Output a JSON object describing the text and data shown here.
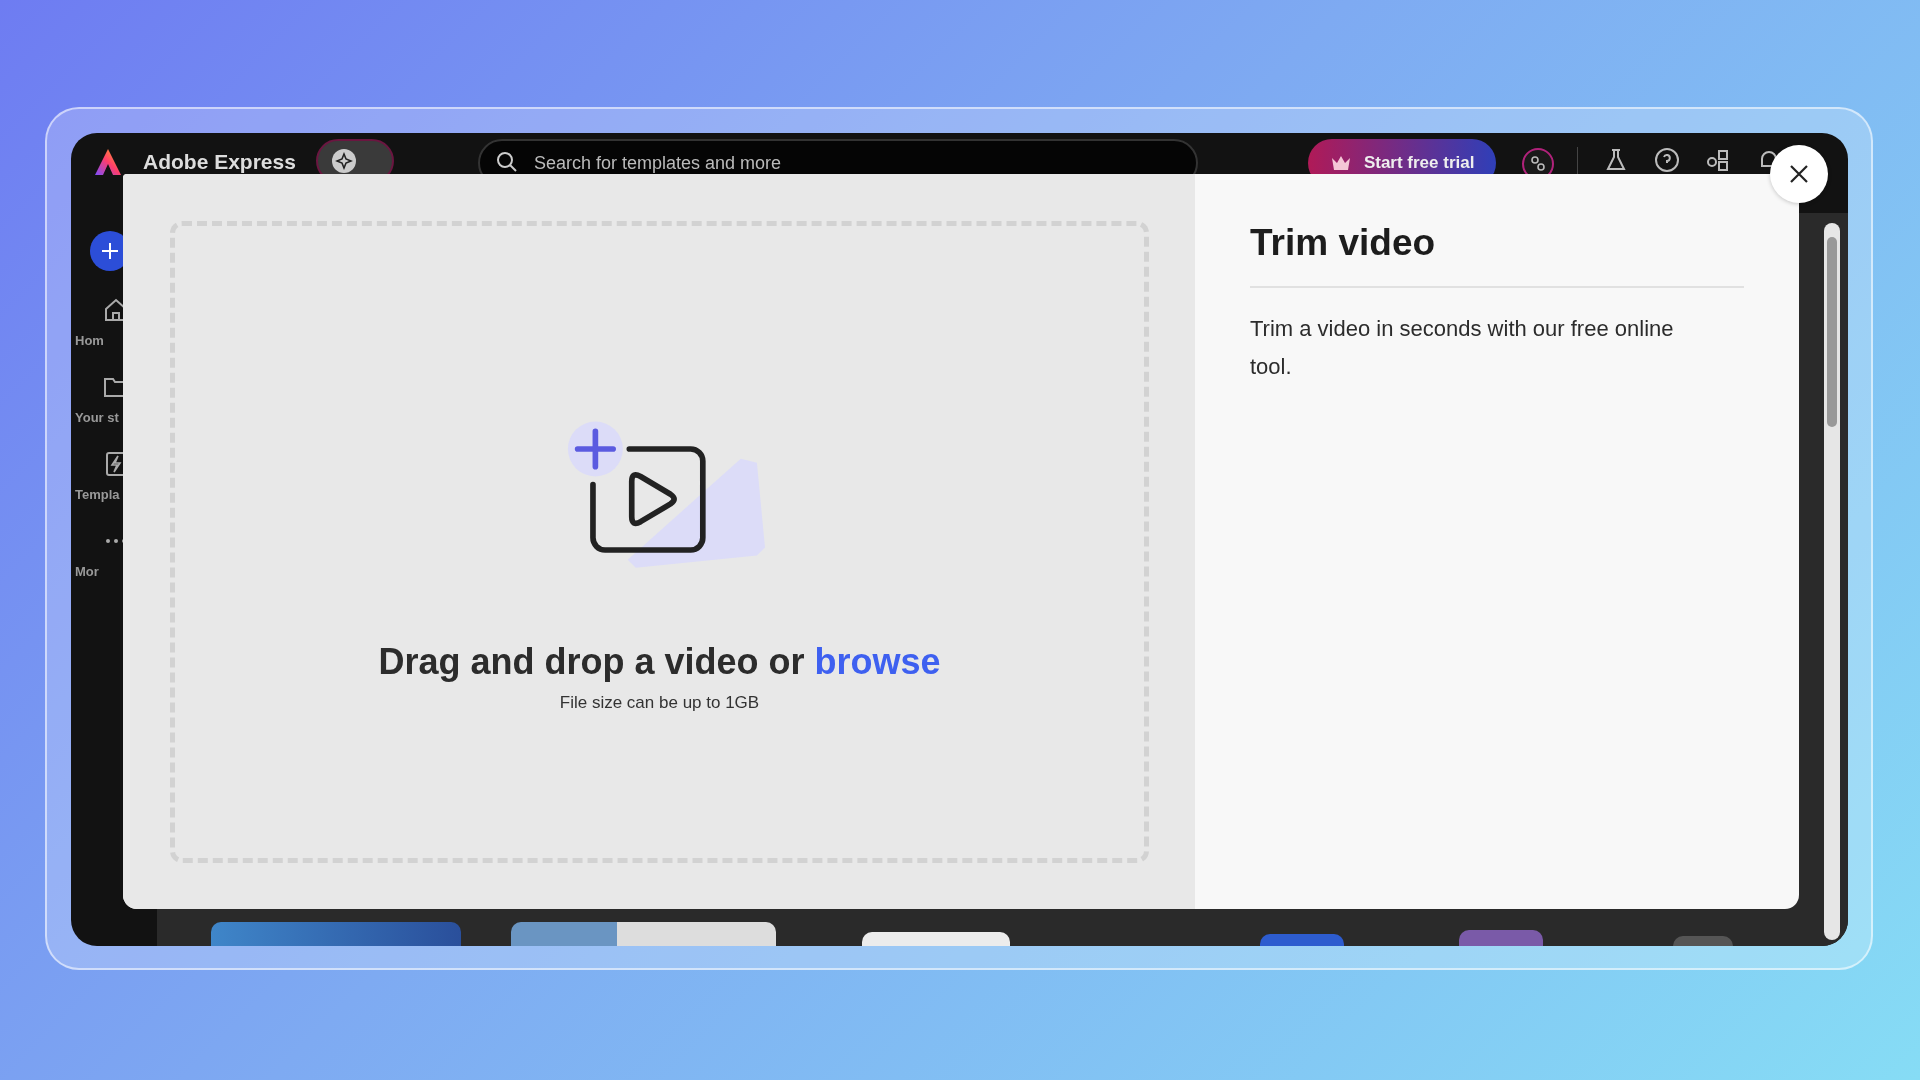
{
  "app": {
    "brand": "Adobe Express",
    "search": {
      "placeholder": "Search for templates and more"
    },
    "trial_button": "Start free trial",
    "sidebar": [
      {
        "kind": "home",
        "label": "Hom"
      },
      {
        "kind": "folder",
        "label": "Your st"
      },
      {
        "kind": "templates",
        "label": "Templa"
      },
      {
        "kind": "more",
        "label": "Mor"
      }
    ]
  },
  "dialog": {
    "drop_text": "Drag and drop a video or",
    "browse_link": "browse",
    "hint": "File size can be up to 1GB",
    "title": "Trim video",
    "description": "Trim a video in seconds with our free online tool."
  }
}
